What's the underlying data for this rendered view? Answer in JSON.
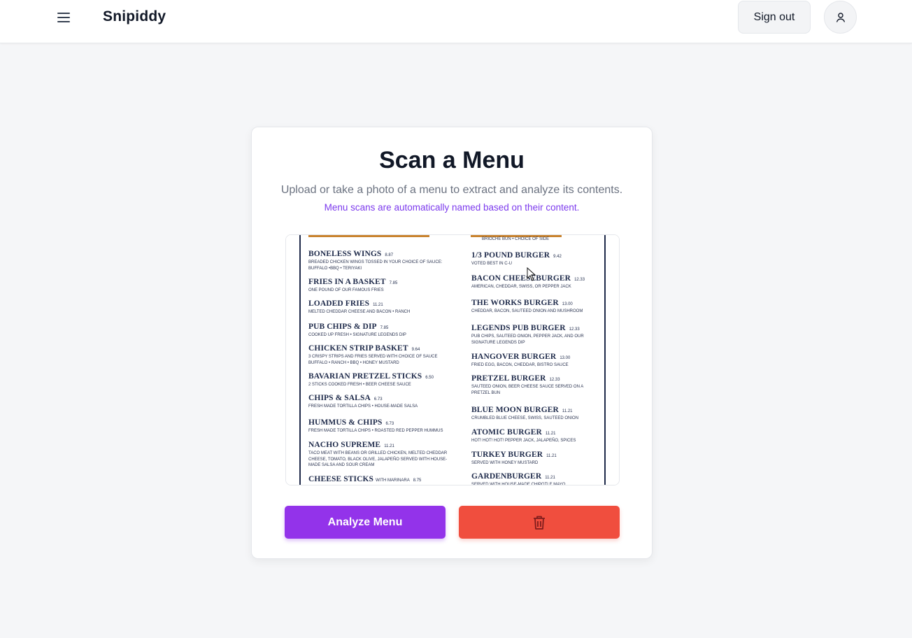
{
  "header": {
    "brand": "Snipiddy",
    "sign_out_label": "Sign out",
    "menu_icon": "hamburger-menu-icon",
    "avatar_icon": "user-icon"
  },
  "card": {
    "title": "Scan a Menu",
    "subtitle": "Upload or take a photo of a menu to extract and analyze its contents.",
    "note": "Menu scans are automatically named based on their content.",
    "analyze_label": "Analyze Menu",
    "delete_icon": "trash-icon"
  },
  "menu_image": {
    "left_column": [
      {
        "name": "BONELESS WINGS",
        "price": "8.87",
        "desc": "BREADED CHICKEN WINGS TOSSED IN YOUR CHOICE OF SAUCE: BUFFALO •BBQ • TERIYAKI"
      },
      {
        "name": "FRIES IN A BASKET",
        "price": "7.85",
        "desc": "ONE POUND OF OUR FAMOUS FRIES"
      },
      {
        "name": "LOADED FRIES",
        "price": "11.21",
        "desc": "MELTED CHEDDAR CHEESE AND BACON • RANCH"
      },
      {
        "name": "PUB CHIPS & DIP",
        "price": "7.85",
        "desc": "COOKED UP FRESH • SIGNATURE LEGENDS DIP"
      },
      {
        "name": "CHICKEN STRIP BASKET",
        "price": "9.64",
        "desc": "3 CRISPY STRIPS AND FRIES SERVED WITH CHOICE OF SAUCE BUFFALO • RANCH • BBQ • HONEY MUSTARD"
      },
      {
        "name": "BAVARIAN PRETZEL STICKS",
        "price": "6.50",
        "desc": "2 STICKS COOKED FRESH • BEER CHEESE SAUCE"
      },
      {
        "name": "CHIPS & SALSA",
        "price": "6.73",
        "desc": "FRESH MADE TORTILLA CHIPS • HOUSE-MADE SALSA"
      },
      {
        "name": "HUMMUS & CHIPS",
        "price": "6.73",
        "desc": "FRESH MADE TORTILLA CHIPS • ROASTED RED PEPPER HUMMUS"
      },
      {
        "name": "NACHO SUPREME",
        "price": "11.21",
        "desc": "TACO MEAT WITH BEANS OR GRILLED CHICKEN, MELTED CHEDDAR CHEESE, TOMATO, BLACK OLIVE, JALAPEÑO SERVED WITH HOUSE-MADE SALSA AND SOUR CREAM"
      },
      {
        "name": "CHEESE STICKS",
        "price": "8.75",
        "desc": "WITH MARINARA"
      }
    ],
    "right_top_desc": "BRIOCHE BUN • CHOICE OF SIDE",
    "right_column": [
      {
        "name": "1/3 POUND BURGER",
        "price": "9.42",
        "desc": "VOTED BEST IN C-U"
      },
      {
        "name": "BACON CHEESEBURGER",
        "price": "12.33",
        "desc": "AMERICAN, CHEDDAR, SWISS, OR PEPPER JACK"
      },
      {
        "name": "THE WORKS BURGER",
        "price": "13.00",
        "desc": "CHEDDAR, BACON, SAUTEED ONION AND MUSHROOM"
      },
      {
        "name": "LEGENDS PUB BURGER",
        "price": "12.33",
        "desc": "PUB CHIPS, SAUTEED ONION, PEPPER JACK, AND OUR SIGNATURE LEGENDS DIP"
      },
      {
        "name": "HANGOVER BURGER",
        "price": "13.00",
        "desc": "FRIED EGG, BACON, CHEDDAR, BISTRO SAUCE"
      },
      {
        "name": "PRETZEL BURGER",
        "price": "12.33",
        "desc": "SAUTEED ONION, BEER CHEESE SAUCE SERVED ON A PRETZEL BUN"
      },
      {
        "name": "BLUE MOON BURGER",
        "price": "11.21",
        "desc": "CRUMBLED BLUE CHEESE, SWISS, SAUTEED ONION"
      },
      {
        "name": "ATOMIC BURGER",
        "price": "11.21",
        "desc": "HOT! HOT! HOT! PEPPER JACK, JALAPEÑO, SPICES"
      },
      {
        "name": "TURKEY BURGER",
        "price": "11.21",
        "desc": "SERVED WITH HONEY MUSTARD"
      },
      {
        "name": "GARDENBURGER",
        "price": "11.21",
        "desc": "SERVED WITH HOUSE-MADE CHIPOTLE MAYO"
      }
    ]
  },
  "colors": {
    "brand_purple": "#9333ea",
    "note_purple": "#7c3aed",
    "delete_red": "#f04e3e",
    "menu_navy": "#1e2a4a",
    "menu_orange": "#c9832e"
  }
}
